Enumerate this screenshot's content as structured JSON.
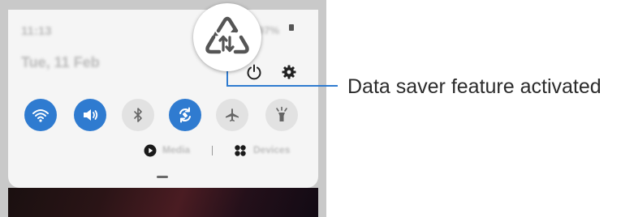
{
  "status_bar": {
    "time": "11:13",
    "date": "Tue, 11 Feb",
    "status_right": "97%"
  },
  "quick_panel": {
    "tiles": [
      {
        "name": "wifi",
        "state": "on"
      },
      {
        "name": "sound",
        "state": "on"
      },
      {
        "name": "bluetooth",
        "state": "off"
      },
      {
        "name": "auto-rotate",
        "state": "on"
      },
      {
        "name": "airplane-mode",
        "state": "off"
      },
      {
        "name": "flashlight",
        "state": "off"
      }
    ],
    "media_label": "Media",
    "devices_label": "Devices"
  },
  "callout": {
    "label": "Data saver feature activated",
    "icon": "data-saver-icon"
  },
  "colors": {
    "tile_on": "#2f7bd0",
    "tile_off": "#e2e2e2",
    "panel_bg": "#f5f5f5",
    "leader_line": "#2f7bd0"
  }
}
